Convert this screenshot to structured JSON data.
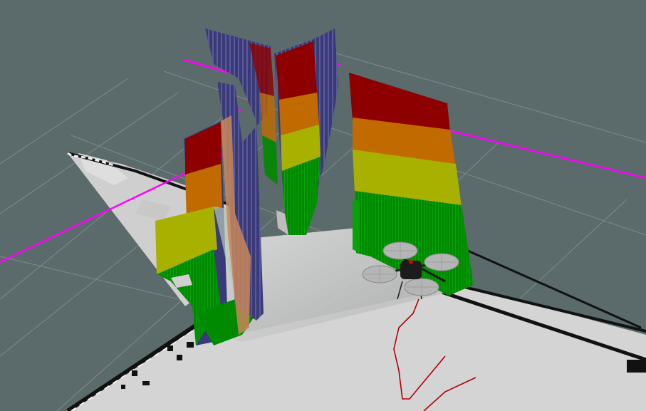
{
  "scene": {
    "background": "#5b6a6a",
    "grid_color": "#8a9696",
    "floor_color": "#d6d6d6",
    "floor_outline_color": "#111111",
    "scanned_floor_color": "#b9b9b9",
    "marker_color": "#ff00ff",
    "path_color": "#b00000",
    "height_colormap": [
      "#008a00",
      "#a8b000",
      "#c06a00",
      "#8e0000",
      "#3a3a78"
    ],
    "robot": {
      "name": "quadrotor",
      "body_color": "#1c1c1c",
      "rotor_color": "#b5b5b5",
      "rotor_count": 4
    }
  }
}
